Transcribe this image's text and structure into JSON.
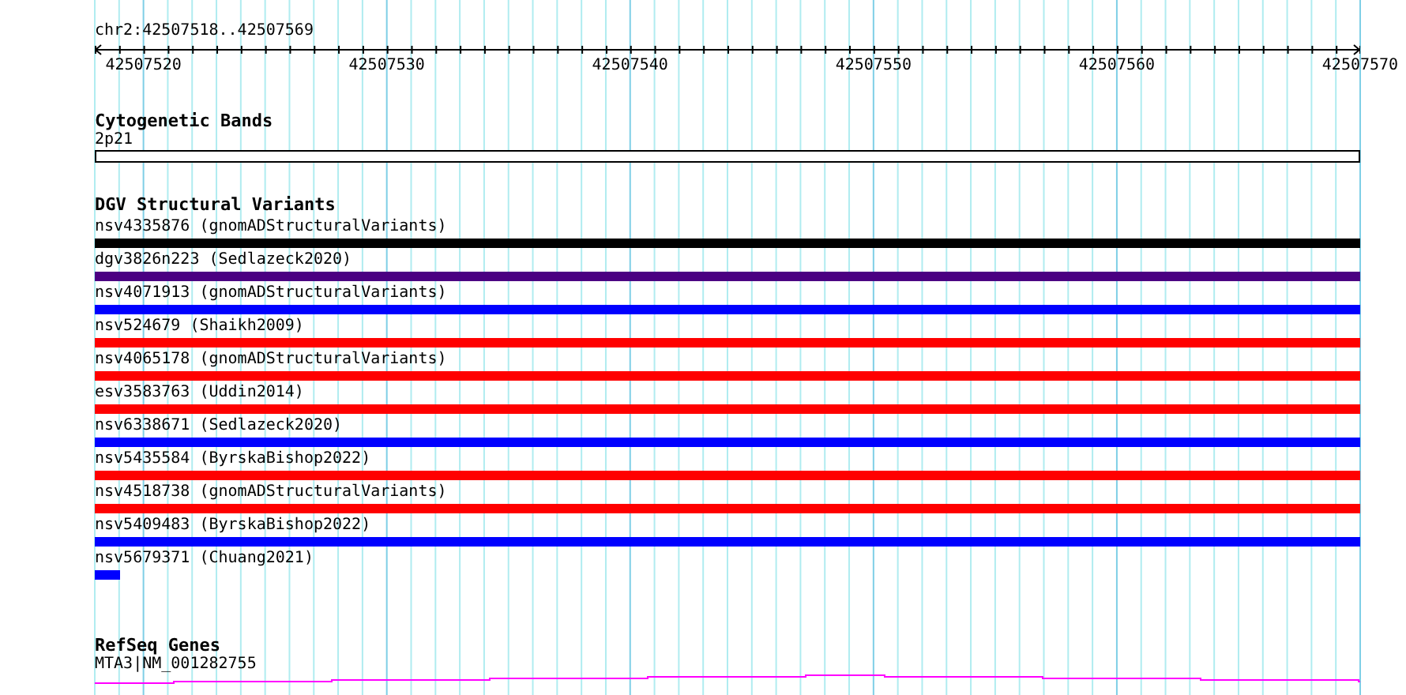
{
  "locus": "chr2:42507518..42507569",
  "ruler": {
    "ticks": [
      "42507520",
      "42507530",
      "42507540",
      "42507550",
      "42507560",
      "42507570"
    ]
  },
  "tracks": [
    {
      "title": "Cytogenetic Bands",
      "kind": "band",
      "features": [
        {
          "label": "2p21"
        }
      ]
    },
    {
      "title": "DGV Structural Variants",
      "kind": "variants",
      "features": [
        {
          "label": "nsv4335876 (gnomADStructuralVariants)",
          "color": "#000000",
          "kind": "full"
        },
        {
          "label": "dgv3826n223 (Sedlazeck2020)",
          "color": "#4b0082",
          "kind": "full"
        },
        {
          "label": "nsv4071913 (gnomADStructuralVariants)",
          "color": "#0000ff",
          "kind": "full"
        },
        {
          "label": "nsv524679 (Shaikh2009)",
          "color": "#ff0000",
          "kind": "full"
        },
        {
          "label": "nsv4065178 (gnomADStructuralVariants)",
          "color": "#ff0000",
          "kind": "full"
        },
        {
          "label": "esv3583763 (Uddin2014)",
          "color": "#ff0000",
          "kind": "full"
        },
        {
          "label": "nsv6338671 (Sedlazeck2020)",
          "color": "#0000ff",
          "kind": "full"
        },
        {
          "label": "nsv5435584 (ByrskaBishop2022)",
          "color": "#ff0000",
          "kind": "full"
        },
        {
          "label": "nsv4518738 (gnomADStructuralVariants)",
          "color": "#ff0000",
          "kind": "full"
        },
        {
          "label": "nsv5409483 (ByrskaBishop2022)",
          "color": "#0000ff",
          "kind": "full"
        },
        {
          "label": "nsv5679371 (Chuang2021)",
          "color": "#0000ff",
          "kind": "short"
        }
      ]
    },
    {
      "title": "RefSeq Genes",
      "kind": "gene",
      "features": [
        {
          "label": "MTA3|NM_001282755"
        }
      ]
    }
  ]
}
